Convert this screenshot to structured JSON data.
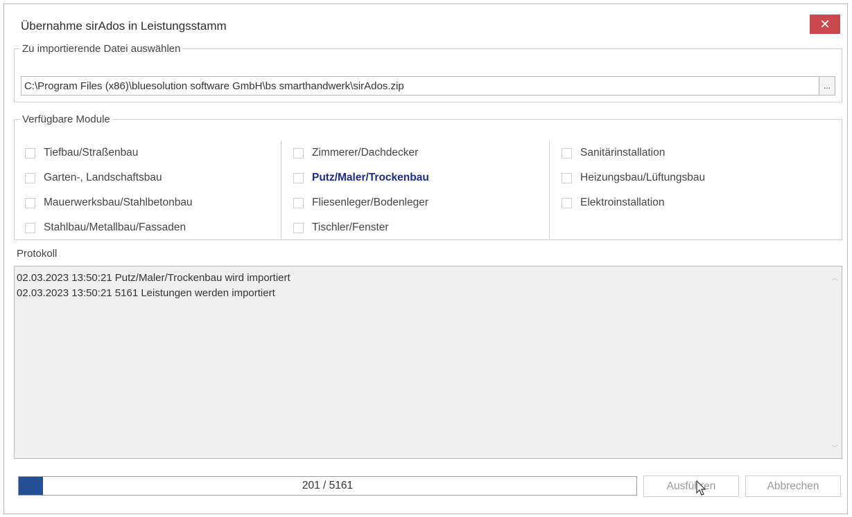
{
  "window": {
    "title": "Übernahme sirAdos in Leistungsstamm",
    "close_icon": "close-icon",
    "close_color": "#c9494c"
  },
  "file_group": {
    "legend": "Zu importierende Datei auswählen",
    "path_value": "C:\\Program Files (x86)\\bluesolution software GmbH\\bs smarthandwerk\\sirAdos.zip",
    "browse_label": "..."
  },
  "modules_group": {
    "legend": "Verfügbare Module",
    "columns": [
      {
        "items": [
          {
            "label": "Tiefbau/Straßenbau",
            "checked": false,
            "highlighted": false
          },
          {
            "label": "Garten-, Landschaftsbau",
            "checked": false,
            "highlighted": false
          },
          {
            "label": "Mauerwerksbau/Stahlbetonbau",
            "checked": false,
            "highlighted": false
          },
          {
            "label": "Stahlbau/Metallbau/Fassaden",
            "checked": false,
            "highlighted": false
          }
        ]
      },
      {
        "items": [
          {
            "label": "Zimmerer/Dachdecker",
            "checked": false,
            "highlighted": false
          },
          {
            "label": "Putz/Maler/Trockenbau",
            "checked": false,
            "highlighted": true
          },
          {
            "label": "Fliesenleger/Bodenleger",
            "checked": false,
            "highlighted": false
          },
          {
            "label": "Tischler/Fenster",
            "checked": false,
            "highlighted": false
          }
        ]
      },
      {
        "items": [
          {
            "label": "Sanitärinstallation",
            "checked": false,
            "highlighted": false
          },
          {
            "label": "Heizungsbau/Lüftungsbau",
            "checked": false,
            "highlighted": false
          },
          {
            "label": "Elektroinstallation",
            "checked": false,
            "highlighted": false
          }
        ]
      }
    ],
    "highlight_color": "#1c2a8a"
  },
  "protokoll": {
    "label": "Protokoll",
    "lines": [
      "02.03.2023 13:50:21 Putz/Maler/Trockenbau wird importiert",
      "02.03.2023 13:50:21 5161 Leistungen werden importiert"
    ]
  },
  "progress": {
    "current": 201,
    "total": 5161,
    "text": "201 / 5161",
    "fill_color": "#254f94"
  },
  "buttons": {
    "run_label": "Ausführen",
    "cancel_label": "Abbrechen"
  }
}
